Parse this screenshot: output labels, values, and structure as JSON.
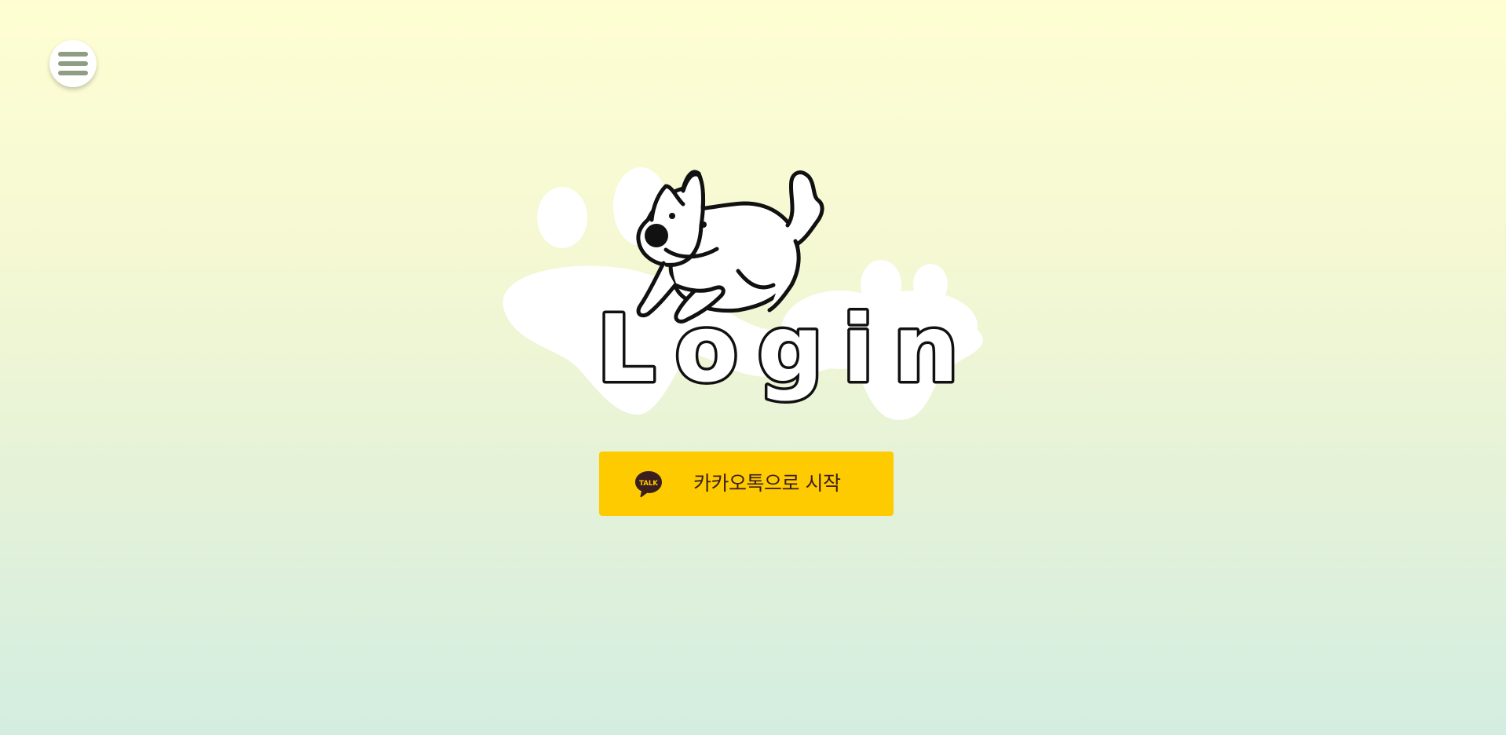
{
  "header": {
    "menu_icon": "hamburger-menu-icon"
  },
  "hero": {
    "illustration": "dog-on-paw-print",
    "title": "Login"
  },
  "login": {
    "kakao_label": "카카오톡으로 시작",
    "kakao_icon_text": "TALK",
    "kakao_icon": "kakaotalk-bubble-icon"
  },
  "colors": {
    "background_top": "#fffed3",
    "background_bottom": "#d3ede0",
    "kakao_yellow": "#fecb00",
    "kakao_brown": "#3b1e1e",
    "menu_bars": "#8e9e84"
  }
}
